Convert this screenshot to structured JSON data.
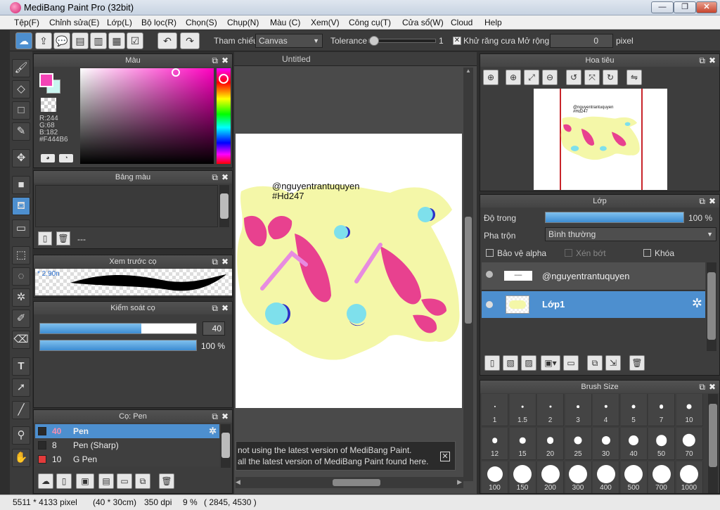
{
  "window": {
    "title": "MediBang Paint Pro (32bit)",
    "min": "—",
    "max": "❐",
    "close": "✕"
  },
  "menu": [
    "Tệp(F)",
    "Chỉnh sửa(E)",
    "Lớp(L)",
    "Bộ lọc(R)",
    "Chọn(S)",
    "Chụp(N)",
    "Màu (C)",
    "Xem(V)",
    "Công cụ(T)",
    "Cửa sổ(W)",
    "Cloud",
    "Help"
  ],
  "toolbar": {
    "reference_label": "Tham chiếu",
    "reference_value": "Canvas",
    "tolerance_label": "Tolerance",
    "tolerance_value": "1",
    "antialias_label": "Khử răng cưa",
    "antialias_checked": true,
    "expand_label": "Mở rộng",
    "expand_value": "0",
    "expand_unit": "pixel"
  },
  "color_panel": {
    "title": "Màu",
    "r": "R:244",
    "g": "G:68",
    "b": "B:182",
    "hex": "#F444B6",
    "foreground": "#F444B6",
    "background": "#c8f5ef"
  },
  "palette_panel": {
    "title": "Bảng màu",
    "item": "---"
  },
  "brush_preview": {
    "title": "Xem trước cọ",
    "size": "2.90n"
  },
  "brush_control": {
    "title": "Kiểm soát cọ",
    "size_value": "40",
    "size_fraction": 0.65,
    "opacity_value": "100 %",
    "opacity_fraction": 1.0
  },
  "brush_panel": {
    "title": "Cọ: Pen",
    "items": [
      {
        "size": "40",
        "name": "Pen",
        "color": "#2a2a2a",
        "selected": true
      },
      {
        "size": "8",
        "name": "Pen (Sharp)",
        "color": "#2a2a2a",
        "selected": false
      },
      {
        "size": "10",
        "name": "G Pen",
        "color": "#e23b3b",
        "selected": false
      }
    ]
  },
  "canvas": {
    "tab": "Untitled",
    "watermark_line1": "@nguyentrantuquyen",
    "watermark_line2": "#Hd247",
    "notice_line1": "not using the latest version of MediBang Paint.",
    "notice_line2": "all the latest version of MediBang Paint found here."
  },
  "navigator": {
    "title": "Hoa tiêu",
    "line1": "@nguyentrantuquyen",
    "line2": "#Hd247"
  },
  "layer_panel": {
    "title": "Lớp",
    "opacity_label": "Độ trong",
    "opacity_value": "100 %",
    "opacity_fraction": 1.0,
    "blend_label": "Pha trộn",
    "blend_value": "Bình thường",
    "protect_alpha": "Bảo vệ alpha",
    "clipping": "Xén bớt",
    "lock": "Khóa",
    "layers": [
      {
        "name": "@nguyentrantuquyen",
        "selected": false
      },
      {
        "name": "Lớp1",
        "selected": true
      }
    ]
  },
  "brush_size_panel": {
    "title": "Brush Size",
    "sizes": [
      "1",
      "1.5",
      "2",
      "3",
      "4",
      "5",
      "7",
      "10",
      "12",
      "15",
      "20",
      "25",
      "30",
      "40",
      "50",
      "70",
      "100",
      "150",
      "200",
      "300",
      "400",
      "500",
      "700",
      "1000"
    ]
  },
  "status": {
    "dimensions": "5511 * 4133 pixel",
    "physical": "(40 * 30cm)",
    "dpi": "350 dpi",
    "zoom": "9 %",
    "cursor": "( 2845, 4530 )"
  },
  "colors": {
    "accent": "#4d8fcf",
    "pink": "#F444B6",
    "blob": "#f4f7a8",
    "cyan": "#7ee0ec",
    "blue": "#2b32c8"
  }
}
